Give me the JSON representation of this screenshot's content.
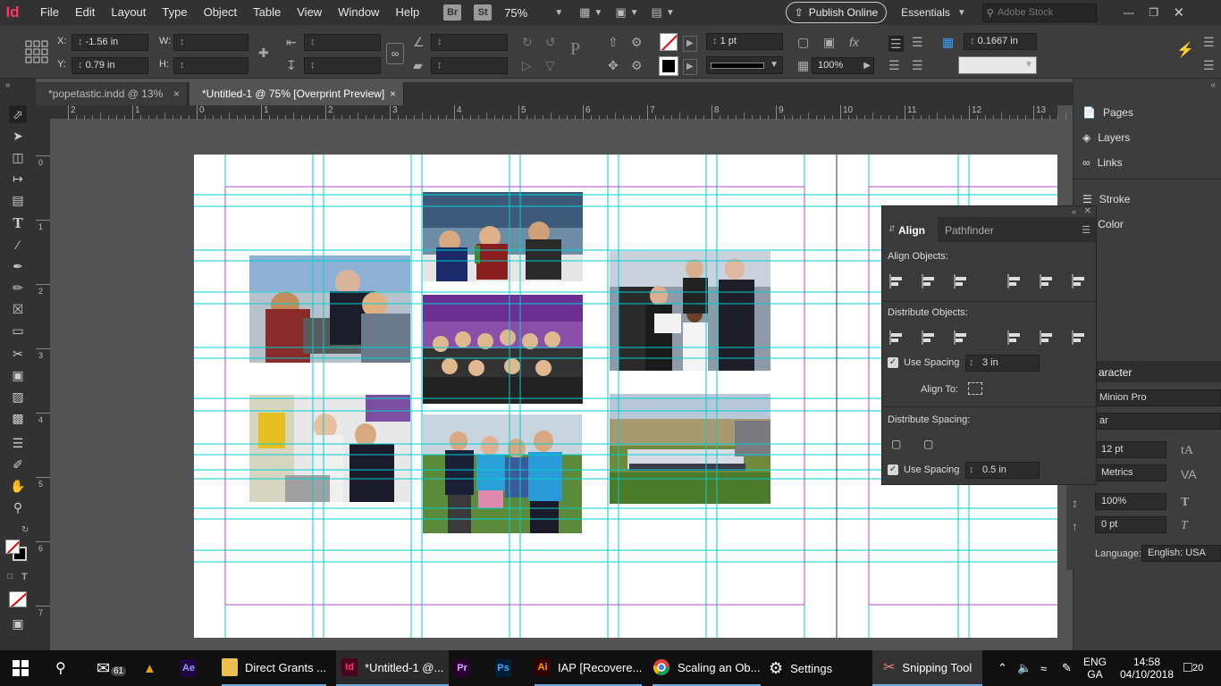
{
  "menubar": {
    "logo": "Id",
    "items": [
      "File",
      "Edit",
      "Layout",
      "Type",
      "Object",
      "Table",
      "View",
      "Window",
      "Help"
    ],
    "bridge": "Br",
    "stock": "St",
    "zoom": "75%",
    "publish_label": "Publish Online",
    "workspace": "Essentials",
    "search_placeholder": "Adobe Stock"
  },
  "control": {
    "x_label": "X:",
    "x_value": "-1.56 in",
    "y_label": "Y:",
    "y_value": "0.79 in",
    "w_label": "W:",
    "h_label": "H:",
    "stroke_weight": "1 pt",
    "scale_pct": "100%",
    "gutter": "0.1667 in"
  },
  "tabs": [
    {
      "label": "*popetastic.indd @ 13%",
      "close": "×"
    },
    {
      "label": "*Untitled-1 @ 75% [Overprint Preview]",
      "close": "×"
    }
  ],
  "ruler": {
    "h_ticks": [
      "2",
      "1",
      "0",
      "1",
      "2",
      "3",
      "4",
      "5",
      "6",
      "7",
      "8",
      "9",
      "10",
      "11",
      "12",
      "13"
    ],
    "v_ticks": [
      "0",
      "1",
      "2",
      "3",
      "4",
      "5",
      "6",
      "7"
    ]
  },
  "panels": {
    "pages": "Pages",
    "layers": "Layers",
    "links": "Links",
    "stroke": "Stroke",
    "color": "Color"
  },
  "align": {
    "tab_align": "Align",
    "tab_pathfinder": "Pathfinder",
    "align_objects": "Align Objects:",
    "distribute_objects": "Distribute Objects:",
    "use_spacing_1": "Use Spacing",
    "spacing_1": "3 in",
    "align_to": "Align To:",
    "distribute_spacing": "Distribute Spacing:",
    "use_spacing_2": "Use Spacing",
    "spacing_2": "0.5 in"
  },
  "character": {
    "title": "aracter",
    "font": "Minion Pro",
    "style": "ar",
    "size": "12 pt",
    "leading": "Metrics",
    "vscale": "100%",
    "baseline": "0 pt",
    "language_label": "Language:",
    "language": "English: USA"
  },
  "taskbar": {
    "mail_badge": "61",
    "items": [
      {
        "icon": "Ae",
        "label": ""
      },
      {
        "icon": "folder",
        "label": "Direct Grants ..."
      },
      {
        "icon": "Id",
        "label": "*Untitled-1 @..."
      },
      {
        "icon": "Pr",
        "label": ""
      },
      {
        "icon": "Ps",
        "label": ""
      },
      {
        "icon": "Ai",
        "label": "IAP [Recovere..."
      },
      {
        "icon": "chrome",
        "label": "Scaling an Ob..."
      },
      {
        "icon": "gear",
        "label": "Settings"
      },
      {
        "icon": "snip",
        "label": "Snipping Tool"
      }
    ],
    "lang1": "ENG",
    "lang2": "GA",
    "time": "14:58",
    "date": "04/10/2018",
    "notif": "20"
  },
  "colors": {
    "guide": "#00d0d0",
    "margin": "#b04ac8",
    "accent": "#ff3366"
  }
}
